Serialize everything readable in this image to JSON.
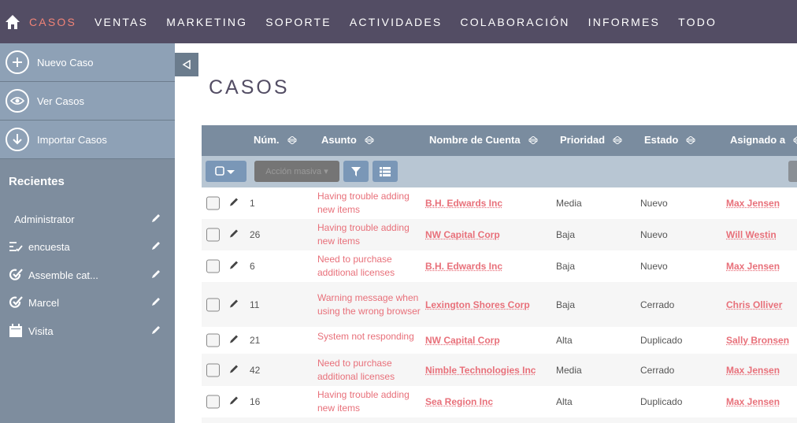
{
  "nav": {
    "items": [
      "CASOS",
      "VENTAS",
      "MARKETING",
      "SOPORTE",
      "ACTIVIDADES",
      "COLABORACIÓN",
      "INFORMES",
      "TODO"
    ],
    "active": "CASOS"
  },
  "sidebar": {
    "actions": [
      "Nuevo Caso",
      "Ver Casos",
      "Importar Casos"
    ],
    "recientes_title": "Recientes",
    "recent": [
      {
        "label": "Administrator",
        "icon": "none"
      },
      {
        "label": "encuesta",
        "icon": "survey-icon"
      },
      {
        "label": "Assemble cat...",
        "icon": "case-check-icon"
      },
      {
        "label": "Marcel",
        "icon": "case-check-icon"
      },
      {
        "label": "Visita",
        "icon": "calendar-icon"
      }
    ]
  },
  "page_title": "CASOS",
  "table": {
    "headers": [
      "Núm.",
      "Asunto",
      "Nombre de Cuenta",
      "Prioridad",
      "Estado",
      "Asignado a"
    ],
    "mass_action": "Acción masiva",
    "rows": [
      {
        "num": "1",
        "asunto": "Having trouble adding new items",
        "cuenta": "B.H. Edwards Inc",
        "prioridad": "Media",
        "estado": "Nuevo",
        "asignado": "Max Jensen"
      },
      {
        "num": "26",
        "asunto": "Having trouble adding new items",
        "cuenta": "NW Capital Corp",
        "prioridad": "Baja",
        "estado": "Nuevo",
        "asignado": "Will Westin"
      },
      {
        "num": "6",
        "asunto": "Need to purchase additional licenses",
        "cuenta": "B.H. Edwards Inc",
        "prioridad": "Baja",
        "estado": "Nuevo",
        "asignado": "Max Jensen"
      },
      {
        "num": "11",
        "asunto": "Warning message when using the wrong browser",
        "cuenta": "Lexington Shores Corp",
        "prioridad": "Baja",
        "estado": "Cerrado",
        "asignado": "Chris Olliver"
      },
      {
        "num": "21",
        "asunto": "System not responding",
        "cuenta": "NW Capital Corp",
        "prioridad": "Alta",
        "estado": "Duplicado",
        "asignado": "Sally Bronsen"
      },
      {
        "num": "42",
        "asunto": "Need to purchase additional licenses",
        "cuenta": "Nimble Technologies Inc",
        "prioridad": "Media",
        "estado": "Cerrado",
        "asignado": "Max Jensen"
      },
      {
        "num": "16",
        "asunto": "Having trouble adding new items",
        "cuenta": "Sea Region Inc",
        "prioridad": "Alta",
        "estado": "Duplicado",
        "asignado": "Max Jensen"
      }
    ]
  },
  "colors": {
    "nav_bg": "#534d64",
    "accent": "#f08377",
    "link": "#e8707a",
    "sidebar_bg": "#7e8d9e"
  }
}
